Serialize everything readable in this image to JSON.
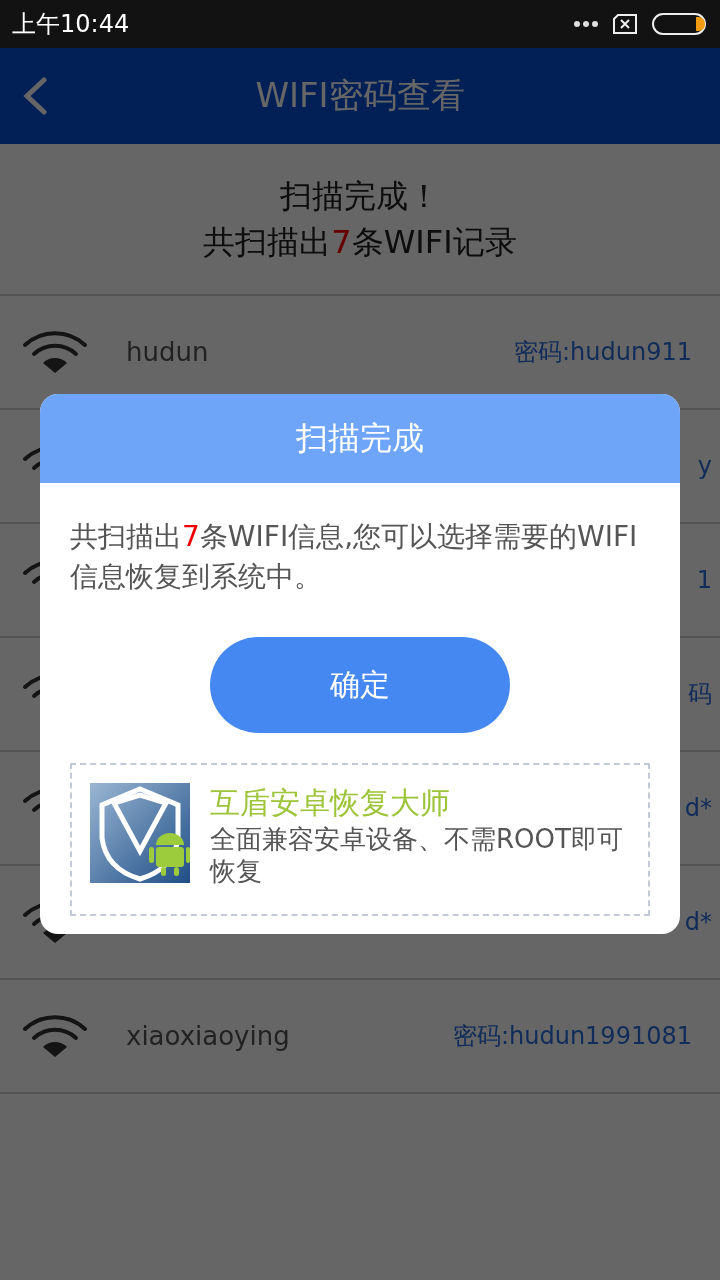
{
  "status_bar": {
    "time": "上午10:44"
  },
  "header": {
    "title": "WIFI密码查看"
  },
  "summary": {
    "title": "扫描完成！",
    "prefix": "共扫描出",
    "count": "7",
    "suffix": "条WIFI记录"
  },
  "networks": [
    {
      "name": "hudun",
      "password": "密码:hudun911"
    },
    {
      "password": "y"
    },
    {
      "password": "1"
    },
    {
      "password": "码"
    },
    {
      "password": "d*"
    },
    {
      "password": "d*"
    },
    {
      "name": "xiaoxiaoying",
      "password": "密码:hudun1991081"
    }
  ],
  "dialog": {
    "title": "扫描完成",
    "prefix": "共扫描出",
    "count": "7",
    "suffix": "条WIFI信息,您可以选择需要的WIFI信息恢复到系统中。",
    "button": "确定",
    "promo": {
      "title": "互盾安卓恢复大师",
      "text": "全面兼容安卓设备、不需ROOT即可恢复"
    }
  }
}
